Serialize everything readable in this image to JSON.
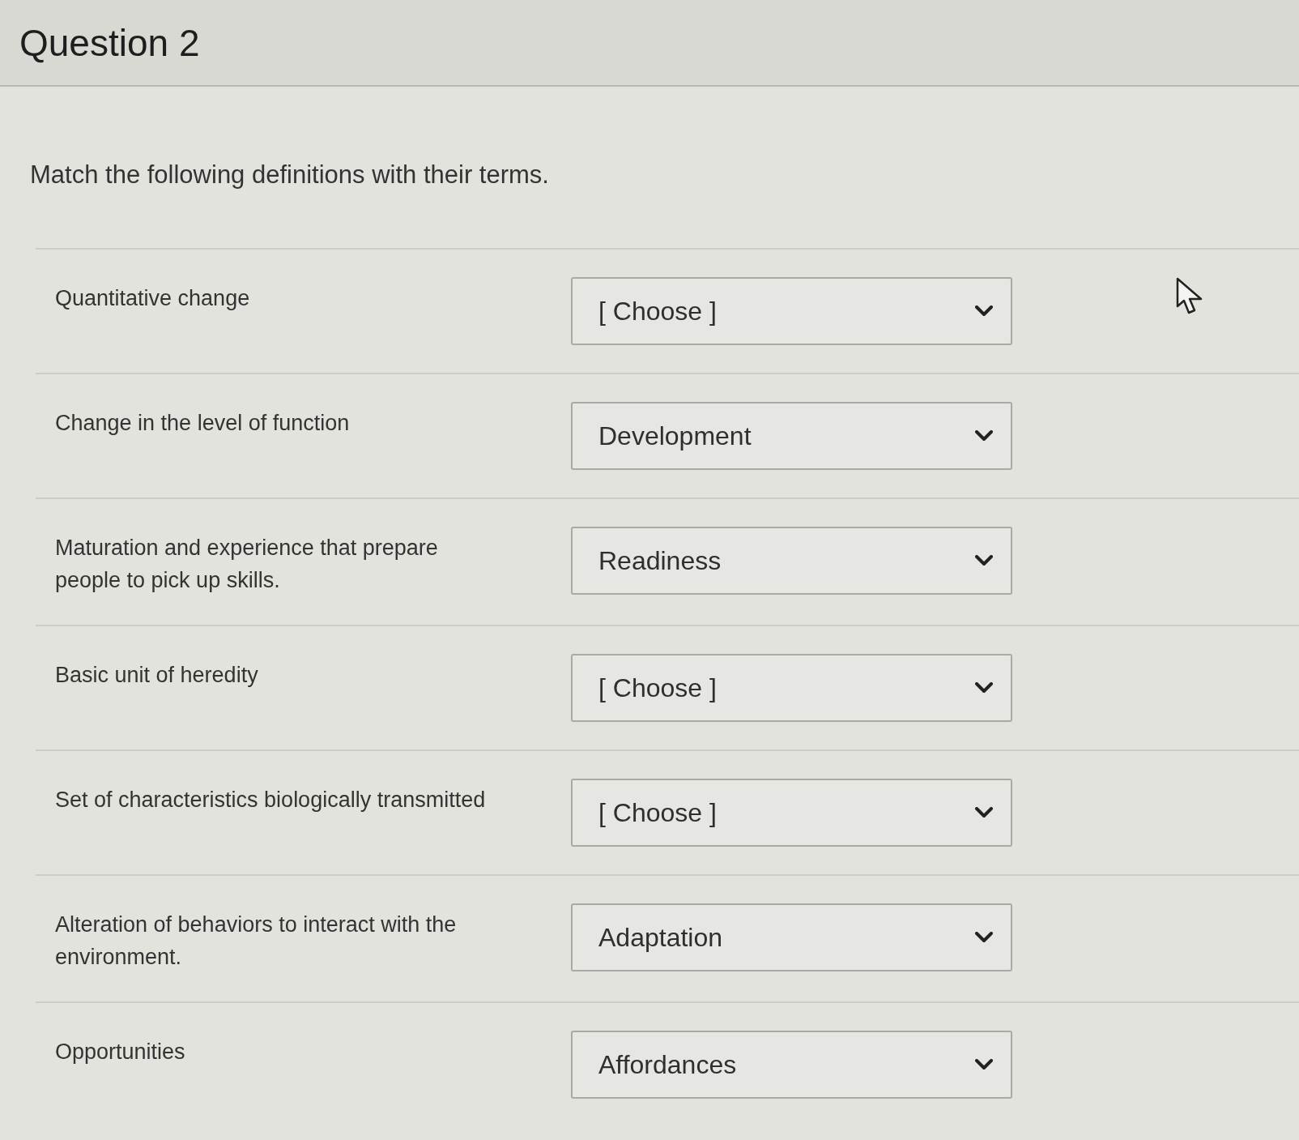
{
  "title": "Question 2",
  "instructions": "Match the following definitions with their terms.",
  "matches": [
    {
      "definition": "Quantitative change",
      "value": "[ Choose ]"
    },
    {
      "definition": "Change in the level of function",
      "value": "Development"
    },
    {
      "definition": "Maturation and experience that prepare people to pick up skills.",
      "value": "Readiness"
    },
    {
      "definition": "Basic unit of heredity",
      "value": "[ Choose ]"
    },
    {
      "definition": "Set of characteristics biologically transmitted",
      "value": "[ Choose ]"
    },
    {
      "definition": "Alteration of behaviors to interact with the environment.",
      "value": "Adaptation"
    },
    {
      "definition": "Opportunities",
      "value": "Affordances"
    }
  ]
}
